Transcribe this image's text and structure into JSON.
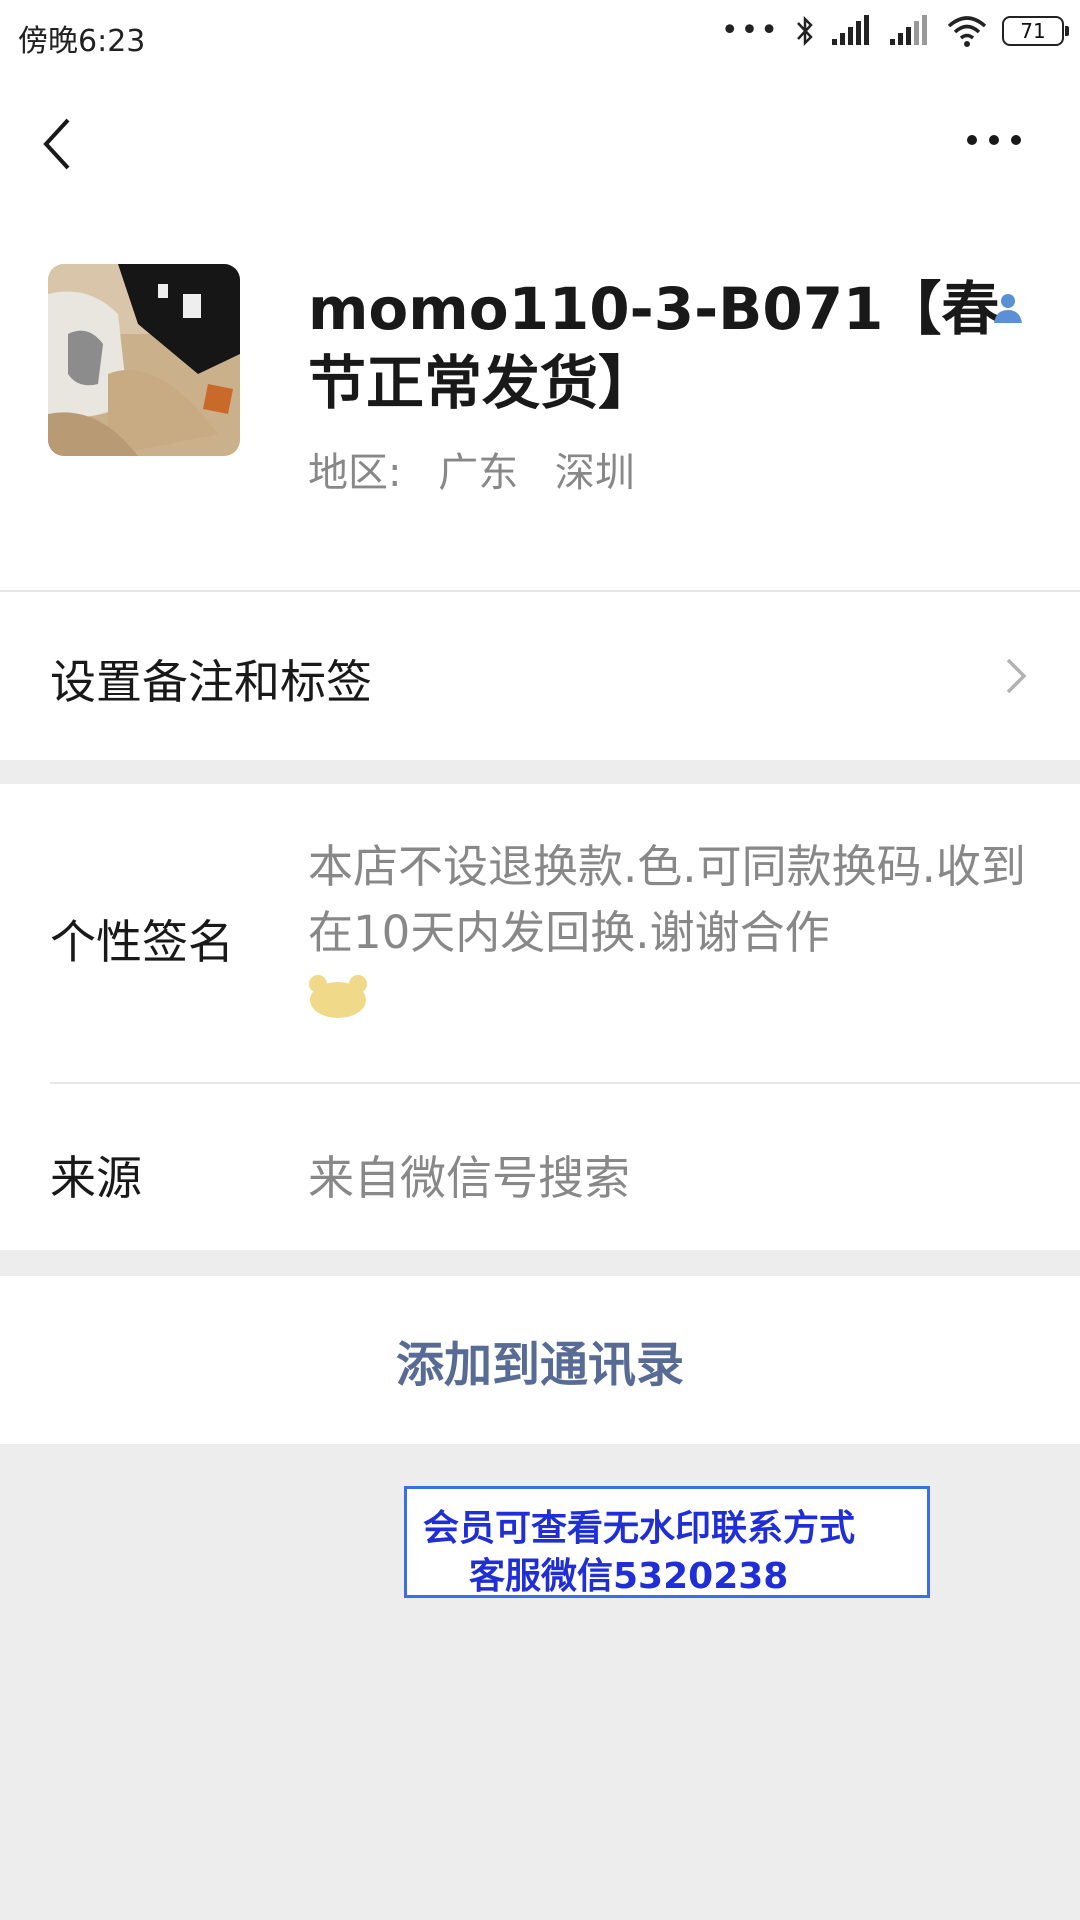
{
  "status_bar": {
    "time": "傍晚6:23",
    "dots": "•••",
    "battery": "71"
  },
  "nav": {
    "back": "back",
    "more": "more"
  },
  "profile": {
    "name": "momo110-3-B071【春节正常发货】",
    "region_label": "地区:",
    "region_province": "广东",
    "region_city": "深圳"
  },
  "remark": {
    "label": "设置备注和标签"
  },
  "signature": {
    "label": "个性签名",
    "text": "本店不设退换款.色.可同款换码.收到在10天内发回换.谢谢合作"
  },
  "source": {
    "label": "来源",
    "value": "来自微信号搜索"
  },
  "actions": {
    "add_to_contacts": "添加到通讯录"
  },
  "watermark": {
    "line1": "会员可查看无水印联系方式",
    "line2": "客服微信5320238"
  },
  "colors": {
    "link": "#576b95",
    "secondary_text": "#888888",
    "page_bg": "#ededed",
    "watermark_text": "#1f2ed6",
    "watermark_border": "#3a6fe6",
    "contact_icon": "#5b8fd6"
  }
}
